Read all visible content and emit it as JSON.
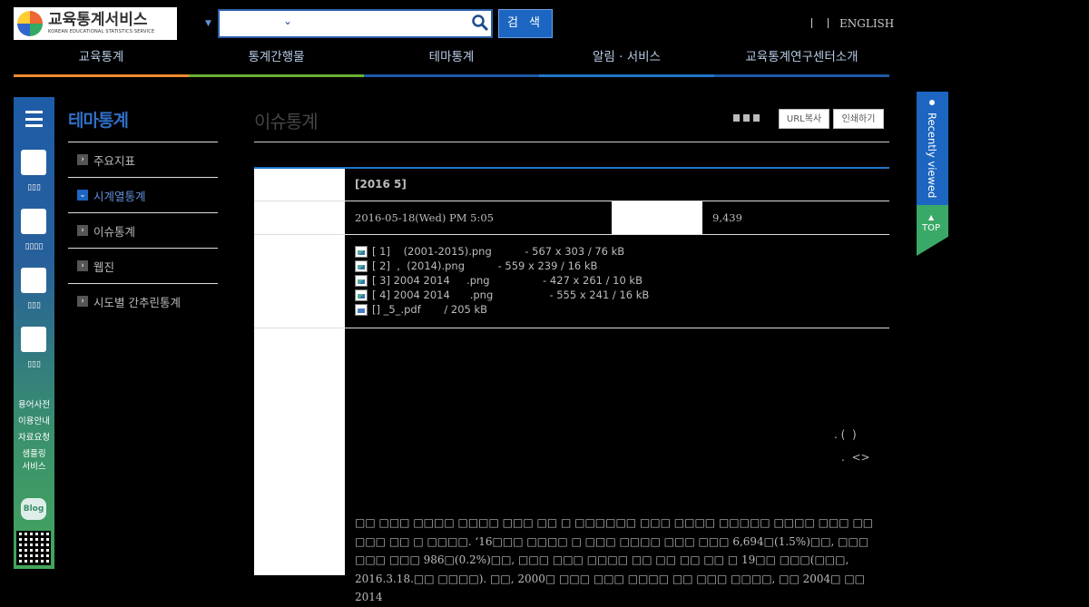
{
  "header": {
    "logo_ko": "교육통계서비스",
    "logo_en": "KOREAN EDUCATIONAL STATISTICS SERVICE",
    "search_button": "검 색",
    "english_link": "ENGLISH"
  },
  "gnb": [
    {
      "label": "교육통계"
    },
    {
      "label": "통계간행물"
    },
    {
      "label": "테마통계"
    },
    {
      "label": "알림 · 서비스"
    },
    {
      "label": "교육통계연구센터소개"
    }
  ],
  "quickbar": {
    "links": [
      "용어사전",
      "이용안내",
      "자료요청",
      "샘플링",
      "서비스"
    ],
    "blog": "Blog"
  },
  "subnav": {
    "title": "테마통계",
    "items": [
      {
        "label": "주요지표",
        "active": false
      },
      {
        "label": "시계열통계",
        "active": true
      },
      {
        "label": "이슈통계",
        "active": false
      },
      {
        "label": "웹진",
        "active": false
      },
      {
        "label": "시도별 간추린통계",
        "active": false
      }
    ]
  },
  "main": {
    "title": "이슈통계",
    "url_copy": "URL복사",
    "print": "인쇄하기",
    "post_title": "[2016 5]",
    "date": "2016-05-18(Wed) PM 5:05",
    "views": "9,439",
    "files": [
      {
        "name": "[ 1]    (2001-2015).png",
        "meta": "- 567 x 303 / 76 kB",
        "gap": "          "
      },
      {
        "name": "[ 2]  ,  (2014).png",
        "meta": "- 559 x 239 / 16 kB",
        "gap": "          "
      },
      {
        "name": "[ 3] 2004 2014     .png",
        "meta": "- 427 x 261 / 10 kB",
        "gap": "                "
      },
      {
        "name": "[ 4] 2004 2014      .png",
        "meta": "- 555 x 241 / 16 kB",
        "gap": "                 "
      },
      {
        "name": "[] _5_.pdf",
        "meta": "/ 205 kB",
        "gap": "       "
      }
    ],
    "note1": ". (  )",
    "note2": ".  <>",
    "body_text": "  □□ □□□ □□□□ □□□□ □□□ □□ □ □□□□□□ □□□ □□□□ □□□□□ □□□□ □□□ □□ □□□ □□ □ □□□□. ‘16□□□ □□□□ □ □□□ □□□□ □□□ □□□ 6,694□(1.5%)□□, □□□ □□□ □□□ 986□(0.2%)□□, □□□ □□□ □□□□ □□ □□ □□ □□ □ 19□□ □□□(□□□, 2016.3.18.□□ □□□□). □□, 2000□ □□□ □□□ □□□□ □□ □□□ □□□□, □□ 2004□ □□ 2014"
  },
  "widget": {
    "recent": "Recently viewed",
    "top": "TOP"
  },
  "colors": {
    "accent_blue": "#1c66c1",
    "green": "#3aa866",
    "orange": "#f08a30"
  }
}
